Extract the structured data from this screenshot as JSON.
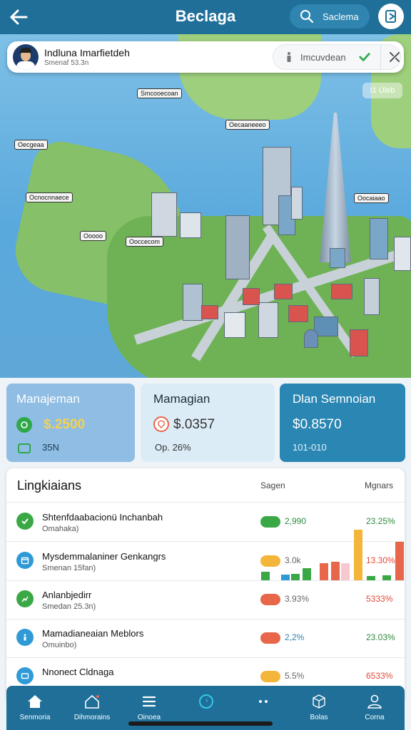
{
  "header": {
    "title": "Beclaga",
    "search_label": "Saclema",
    "back_icon": "arrow-left-icon",
    "profile_icon": "document-icon"
  },
  "profile": {
    "name": "Indluna Imarfietdeh",
    "subtitle": "Smenaf 53.3n",
    "action_label": "Imcuvdean"
  },
  "map": {
    "labels": [
      "Smcooecoan",
      "Oecgeaa",
      "Oecaaneeeo",
      "Ocnocnnaece",
      "Ooooo",
      "Ooccecom",
      "Oocaiaao"
    ],
    "badge": "I1 Uleb"
  },
  "stats": [
    {
      "title": "Manajeman",
      "value": "$.2500",
      "sub": "35N",
      "color": "#8fbde3"
    },
    {
      "title": "Mamagian",
      "value": "$.0357",
      "sub": "Op. 26%",
      "color": "#dcecf7"
    },
    {
      "title": "Dlan Semnoian",
      "value": "$0.8570",
      "sub": "101-010",
      "color": "#2a86b3"
    }
  ],
  "list": {
    "title": "Lingkiaians",
    "col1": "Sagen",
    "col2": "Mgnars",
    "rows": [
      {
        "title": "Shtenfdaabacionü Inchanbah",
        "sub": "Omahaka)",
        "value": "2,990",
        "pct": "23.25%",
        "icon": "check-circle-icon",
        "icon_color": "#3aa845",
        "pill_color": "#3aa845",
        "value_color": "#2e8b3f",
        "pct_color": "#2e8b3f"
      },
      {
        "title": "Mysdemmalaniner Genkangrs",
        "sub": "Smenan 15fan)",
        "value": "3.0k",
        "pct": "13.30%",
        "icon": "calendar-icon",
        "icon_color": "#2f9ad6",
        "pill_color": "#f4b63a",
        "value_color": "#666",
        "pct_color": "#e04a3a"
      },
      {
        "title": "Anlanbjedirr",
        "sub": "Smedan 25.3n)",
        "value": "3.93%",
        "pct": "5333%",
        "icon": "chart-icon",
        "icon_color": "#3aa845",
        "pill_color": "#e8664a",
        "value_color": "#666",
        "pct_color": "#e04a3a"
      },
      {
        "title": "Mamadianeaian Meblors",
        "sub": "Omuinbo)",
        "value": "2,2%",
        "pct": "23.03%",
        "icon": "info-icon",
        "icon_color": "#2f9ad6",
        "pill_color": "#e8664a",
        "value_color": "#2f7fb5",
        "pct_color": "#2e8b3f"
      },
      {
        "title": "Nnonect Cldnaga",
        "sub": "",
        "value": "5.5%",
        "pct": "6533%",
        "icon": "card-icon",
        "icon_color": "#2f9ad6",
        "pill_color": "#f4b63a",
        "value_color": "#666",
        "pct_color": "#e04a3a"
      }
    ]
  },
  "mini_bars": [
    {
      "value": 0.17,
      "color": "#3aa845"
    },
    {
      "value": 0.11,
      "color": "#2f9ad6"
    },
    {
      "value": 0.13,
      "color": "#3aa845"
    },
    {
      "value": 0.24,
      "color": "#3aa845"
    },
    {
      "value": 0.33,
      "color": "#e8664a"
    },
    {
      "value": 0.36,
      "color": "#e8664a"
    },
    {
      "value": 0.33,
      "color": "#f8c8d0"
    },
    {
      "value": 0.98,
      "color": "#f4b63a"
    },
    {
      "value": 0.08,
      "color": "#3aa845"
    },
    {
      "value": 0.1,
      "color": "#3aa845"
    },
    {
      "value": 0.75,
      "color": "#e8664a"
    }
  ],
  "nav": [
    {
      "label": "Senmoria",
      "icon": "home-icon"
    },
    {
      "label": "Dihmorains",
      "icon": "house-outline-icon"
    },
    {
      "label": "Oinoea",
      "icon": "menu-icon"
    },
    {
      "label": "",
      "icon": "compass-icon"
    },
    {
      "label": "",
      "icon": "more-icon"
    },
    {
      "label": "Bolas",
      "icon": "cube-icon"
    },
    {
      "label": "Corna",
      "icon": "user-icon"
    }
  ]
}
